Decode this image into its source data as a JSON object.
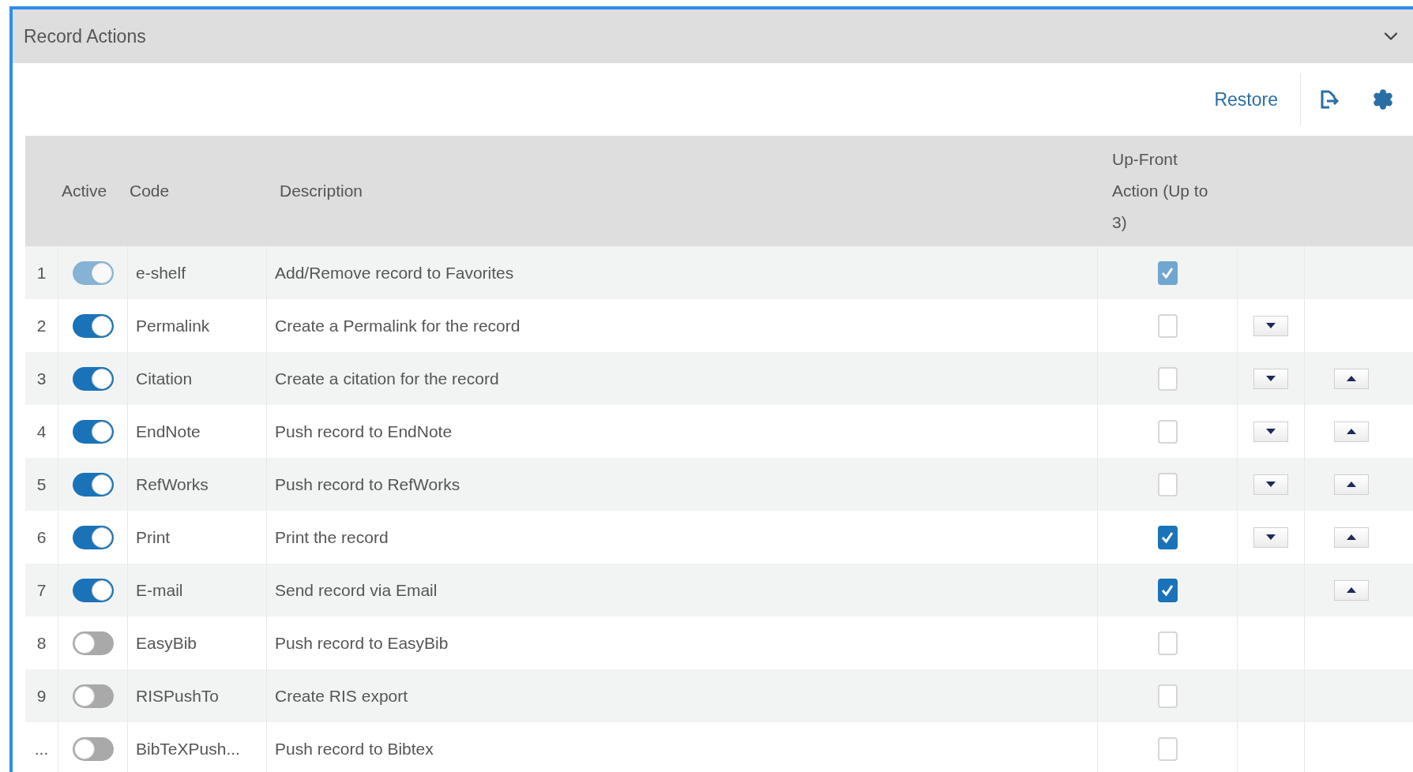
{
  "panel": {
    "title": "Record Actions"
  },
  "toolbar": {
    "restore": "Restore"
  },
  "table": {
    "columns": {
      "active": "Active",
      "code": "Code",
      "description": "Description",
      "up_front": "Up-Front Action (Up to 3)"
    },
    "rows": [
      {
        "index": "1",
        "active": true,
        "locked": true,
        "code": "e-shelf",
        "description": "Add/Remove record to Favorites",
        "up_front": true,
        "move_down": false,
        "move_up": false
      },
      {
        "index": "2",
        "active": true,
        "locked": false,
        "code": "Permalink",
        "description": "Create a Permalink for the record",
        "up_front": false,
        "move_down": true,
        "move_up": false
      },
      {
        "index": "3",
        "active": true,
        "locked": false,
        "code": "Citation",
        "description": "Create a citation for the record",
        "up_front": false,
        "move_down": true,
        "move_up": true
      },
      {
        "index": "4",
        "active": true,
        "locked": false,
        "code": "EndNote",
        "description": "Push record to EndNote",
        "up_front": false,
        "move_down": true,
        "move_up": true
      },
      {
        "index": "5",
        "active": true,
        "locked": false,
        "code": "RefWorks",
        "description": "Push record to RefWorks",
        "up_front": false,
        "move_down": true,
        "move_up": true
      },
      {
        "index": "6",
        "active": true,
        "locked": false,
        "code": "Print",
        "description": "Print the record",
        "up_front": true,
        "move_down": true,
        "move_up": true
      },
      {
        "index": "7",
        "active": true,
        "locked": false,
        "code": "E-mail",
        "description": "Send record via Email",
        "up_front": true,
        "move_down": false,
        "move_up": true
      },
      {
        "index": "8",
        "active": false,
        "locked": false,
        "code": "EasyBib",
        "description": "Push record to EasyBib",
        "up_front": false,
        "move_down": false,
        "move_up": false
      },
      {
        "index": "9",
        "active": false,
        "locked": false,
        "code": "RISPushTo",
        "description": "Create RIS export",
        "up_front": false,
        "move_down": false,
        "move_up": false
      },
      {
        "index": "...",
        "active": false,
        "locked": false,
        "code": "BibTeXPush...",
        "description": "Push record to Bibtex",
        "up_front": false,
        "move_down": false,
        "move_up": false
      }
    ]
  }
}
